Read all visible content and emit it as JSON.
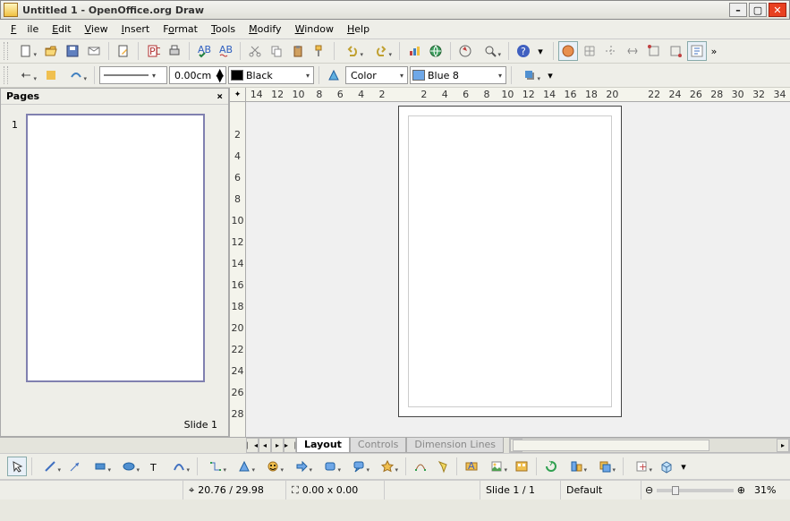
{
  "window": {
    "title": "Untitled 1 - OpenOffice.org Draw"
  },
  "menu": {
    "file": "File",
    "edit": "Edit",
    "view": "View",
    "insert": "Insert",
    "format": "Format",
    "tools": "Tools",
    "modify": "Modify",
    "window": "Window",
    "help": "Help"
  },
  "toolbar2": {
    "line_width": "0.00cm",
    "line_color_label": "Black",
    "line_color_hex": "#000000",
    "area_mode": "Color",
    "area_color_label": "Blue 8",
    "area_color_hex": "#3a7bd5"
  },
  "pages_panel": {
    "title": "Pages",
    "thumb_number": "1",
    "slide_label": "Slide 1"
  },
  "ruler_h": [
    "14",
    "12",
    "10",
    "8",
    "6",
    "4",
    "2",
    "",
    "2",
    "4",
    "6",
    "8",
    "10",
    "12",
    "14",
    "16",
    "18",
    "20",
    "",
    "22",
    "24",
    "26",
    "28",
    "30",
    "32",
    "34"
  ],
  "ruler_v": [
    "",
    "2",
    "4",
    "6",
    "8",
    "10",
    "12",
    "14",
    "16",
    "18",
    "20",
    "22",
    "24",
    "26",
    "28"
  ],
  "tabs": {
    "layout": "Layout",
    "controls": "Controls",
    "dimension": "Dimension Lines"
  },
  "status": {
    "coords": "20.76 / 29.98",
    "size": "0.00 x 0.00",
    "slide": "Slide 1 / 1",
    "layout": "Default",
    "zoom": "31%"
  }
}
